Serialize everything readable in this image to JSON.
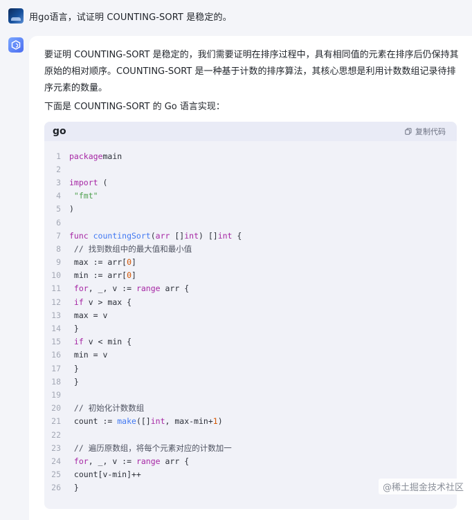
{
  "user": {
    "message": "用go语言，试证明 COUNTING-SORT 是稳定的。"
  },
  "assistant": {
    "paragraph1": "要证明 COUNTING-SORT 是稳定的，我们需要证明在排序过程中，具有相同值的元素在排序后仍保持其原始的相对顺序。COUNTING-SORT 是一种基于计数的排序算法，其核心思想是利用计数数组记录待排序元素的数量。",
    "paragraph2": "下面是 COUNTING-SORT 的 Go 语言实现："
  },
  "code_block": {
    "language": "go",
    "copy_label": "复制代码",
    "lines": [
      {
        "n": "1",
        "segs": [
          [
            "kw",
            "package"
          ],
          [
            "",
            "main"
          ]
        ]
      },
      {
        "n": "2",
        "segs": []
      },
      {
        "n": "3",
        "segs": [
          [
            "kw",
            "import"
          ],
          [
            "",
            " ("
          ]
        ]
      },
      {
        "n": "4",
        "segs": [
          [
            "",
            ""
          ],
          [
            "str",
            " \"fmt\""
          ]
        ]
      },
      {
        "n": "5",
        "segs": [
          [
            "",
            ")"
          ]
        ]
      },
      {
        "n": "6",
        "segs": []
      },
      {
        "n": "7",
        "segs": [
          [
            "kw",
            "func "
          ],
          [
            "fn",
            "countingSort"
          ],
          [
            "",
            "("
          ],
          [
            "kw",
            "arr"
          ],
          [
            "",
            " []"
          ],
          [
            "typ",
            "int"
          ],
          [
            "",
            ") []"
          ],
          [
            "typ",
            "int"
          ],
          [
            "",
            " {"
          ]
        ]
      },
      {
        "n": "8",
        "segs": [
          [
            "com",
            " // 找到数组中的最大值和最小值"
          ]
        ]
      },
      {
        "n": "9",
        "segs": [
          [
            "",
            " max := arr["
          ],
          [
            "num",
            "0"
          ],
          [
            "",
            "]"
          ]
        ]
      },
      {
        "n": "10",
        "segs": [
          [
            "",
            " min := arr["
          ],
          [
            "num",
            "0"
          ],
          [
            "",
            "]"
          ]
        ]
      },
      {
        "n": "11",
        "segs": [
          [
            "kw",
            " for"
          ],
          [
            "",
            ", _, v := "
          ],
          [
            "kw",
            "range"
          ],
          [
            "",
            " arr {"
          ]
        ]
      },
      {
        "n": "12",
        "segs": [
          [
            "kw",
            " if"
          ],
          [
            "",
            " v > max {"
          ]
        ]
      },
      {
        "n": "13",
        "segs": [
          [
            "",
            " max = v"
          ]
        ]
      },
      {
        "n": "14",
        "segs": [
          [
            "",
            " }"
          ]
        ]
      },
      {
        "n": "15",
        "segs": [
          [
            "kw",
            " if"
          ],
          [
            "",
            " v < min {"
          ]
        ]
      },
      {
        "n": "16",
        "segs": [
          [
            "",
            " min = v"
          ]
        ]
      },
      {
        "n": "17",
        "segs": [
          [
            "",
            " }"
          ]
        ]
      },
      {
        "n": "18",
        "segs": [
          [
            "",
            " }"
          ]
        ]
      },
      {
        "n": "19",
        "segs": []
      },
      {
        "n": "20",
        "segs": [
          [
            "com",
            " // 初始化计数数组"
          ]
        ]
      },
      {
        "n": "21",
        "segs": [
          [
            "",
            " count := "
          ],
          [
            "fn",
            "make"
          ],
          [
            "",
            "([]"
          ],
          [
            "typ",
            "int"
          ],
          [
            "",
            ", max-min+"
          ],
          [
            "num",
            "1"
          ],
          [
            "",
            ")"
          ]
        ]
      },
      {
        "n": "22",
        "segs": []
      },
      {
        "n": "23",
        "segs": [
          [
            "com",
            " // 遍历原数组，将每个元素对应的计数加一"
          ]
        ]
      },
      {
        "n": "24",
        "segs": [
          [
            "kw",
            " for"
          ],
          [
            "",
            ", _, v := "
          ],
          [
            "kw",
            "range"
          ],
          [
            "",
            " arr {"
          ]
        ]
      },
      {
        "n": "25",
        "segs": [
          [
            "",
            " count[v-min]++"
          ]
        ]
      },
      {
        "n": "26",
        "segs": [
          [
            "",
            " }"
          ]
        ]
      }
    ]
  },
  "watermark": "@稀土掘金技术社区"
}
